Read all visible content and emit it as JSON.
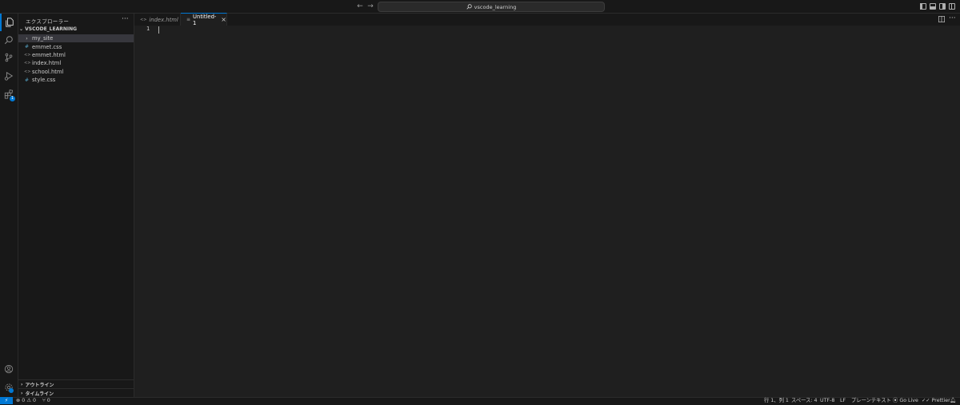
{
  "titlebar": {
    "search_text": "vscode_learning",
    "icons": [
      "arrow-left-icon",
      "arrow-right-icon",
      "search-icon"
    ]
  },
  "activitybar": {
    "items": [
      "explorer-icon",
      "search-icon",
      "source-control-icon",
      "run-debug-icon",
      "extensions-icon"
    ],
    "extensions_badge": "1",
    "bottom": [
      "account-icon",
      "settings-gear-icon"
    ]
  },
  "sidebar": {
    "title": "エクスプローラー",
    "more": "···",
    "folder_name": "VSCODE_LEARNING",
    "items": [
      {
        "label": "my_site",
        "icon": "›",
        "icon_name": "chevron-right-icon"
      },
      {
        "label": "emmet.css",
        "icon": "#",
        "icon_name": "css-file-icon"
      },
      {
        "label": "emmet.html",
        "icon": "<>",
        "icon_name": "html-file-icon"
      },
      {
        "label": "index.html",
        "icon": "<>",
        "icon_name": "html-file-icon"
      },
      {
        "label": "school.html",
        "icon": "<>",
        "icon_name": "html-file-icon"
      },
      {
        "label": "style.css",
        "icon": "#",
        "icon_name": "css-file-icon"
      }
    ],
    "outline_label": "アウトライン",
    "timeline_label": "タイムライン"
  },
  "tabs": [
    {
      "label": "index.html",
      "icon": "<>"
    },
    {
      "label": "Untitled-1",
      "icon": "≡",
      "close": "×"
    }
  ],
  "editor": {
    "line_number": "1"
  },
  "statusbar": {
    "remote": "⚡",
    "errors": "0",
    "warnings": "0",
    "ports": "0",
    "position": "行 1、列 1",
    "spaces": "スペース: 4",
    "encoding": "UTF-8",
    "eol": "LF",
    "language": "プレーンテキスト",
    "golive": "Go Live",
    "prettier": "Prettier"
  },
  "colors": {
    "accent": "#0078d4",
    "background": "#1f1f1f",
    "panel": "#181818"
  }
}
